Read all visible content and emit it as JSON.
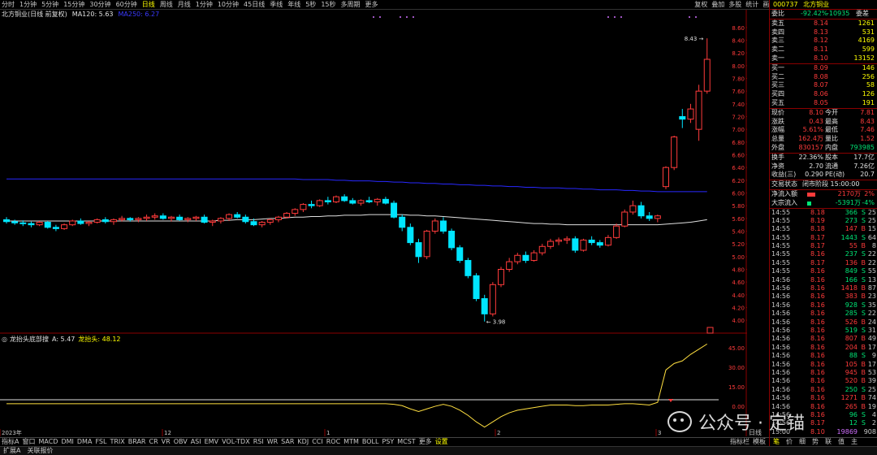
{
  "toolbar": {
    "periods": [
      "分时",
      "1分钟",
      "5分钟",
      "15分钟",
      "30分钟",
      "60分钟",
      "日线",
      "周线",
      "月线",
      "1分钟",
      "10分钟",
      "45日线",
      "季线",
      "年线",
      "5秒",
      "15秒",
      "多周期",
      "更多"
    ],
    "active_period_index": 6,
    "right_buttons": [
      "复权",
      "叠加",
      "多股",
      "统计",
      "画线",
      "F10",
      "标记",
      "+自选",
      "返回"
    ]
  },
  "chart": {
    "stock_label": "北方铜业(日线 前复权)",
    "ma_label": "MA120: 5.63",
    "ma_label2": "MA250: 6.27",
    "high_marker": "8.43",
    "low_marker": "3.98",
    "price_ticks": [
      "8.60",
      "8.40",
      "8.20",
      "8.00",
      "7.80",
      "7.60",
      "7.40",
      "7.20",
      "7.00",
      "6.80",
      "6.60",
      "6.40",
      "6.20",
      "6.00",
      "5.80",
      "5.60",
      "5.40",
      "5.20",
      "5.00",
      "4.80",
      "4.60",
      "4.40",
      "4.20",
      "4.00"
    ],
    "indicator_title": "龙抬头底部搜",
    "indicator_a": "A: 5.47",
    "indicator_b": "龙抬头: 48.12",
    "indicator_ticks": [
      "45.00",
      "30.00",
      "15.00",
      "0.00"
    ],
    "date_labels": [
      "2023年",
      "12",
      "1",
      "2",
      "3"
    ],
    "colors": {
      "up": "#ff3b3b",
      "down": "#00e5ff",
      "ma1": "#e0e0e0",
      "ma2": "#2828ff",
      "indicator": "#ffdf40"
    }
  },
  "chart_data": {
    "type": "candlestick",
    "x": [
      "2023年",
      "12",
      "1",
      "2",
      "3"
    ],
    "y_range": [
      3.9,
      8.7
    ],
    "candles": [
      [
        5.58,
        5.62,
        5.52,
        5.55
      ],
      [
        5.55,
        5.58,
        5.5,
        5.53
      ],
      [
        5.53,
        5.57,
        5.48,
        5.52
      ],
      [
        5.52,
        5.55,
        5.46,
        5.5
      ],
      [
        5.5,
        5.56,
        5.48,
        5.54
      ],
      [
        5.54,
        5.56,
        5.44,
        5.46
      ],
      [
        5.46,
        5.5,
        5.4,
        5.44
      ],
      [
        5.44,
        5.52,
        5.42,
        5.5
      ],
      [
        5.5,
        5.58,
        5.48,
        5.56
      ],
      [
        5.56,
        5.6,
        5.5,
        5.52
      ],
      [
        5.52,
        5.56,
        5.48,
        5.54
      ],
      [
        5.54,
        5.6,
        5.52,
        5.58
      ],
      [
        5.58,
        5.62,
        5.52,
        5.55
      ],
      [
        5.55,
        5.6,
        5.5,
        5.58
      ],
      [
        5.58,
        5.64,
        5.55,
        5.6
      ],
      [
        5.6,
        5.62,
        5.55,
        5.58
      ],
      [
        5.58,
        5.62,
        5.54,
        5.6
      ],
      [
        5.6,
        5.66,
        5.56,
        5.62
      ],
      [
        5.62,
        5.68,
        5.58,
        5.64
      ],
      [
        5.64,
        5.68,
        5.58,
        5.6
      ],
      [
        5.6,
        5.64,
        5.55,
        5.62
      ],
      [
        5.62,
        5.66,
        5.56,
        5.58
      ],
      [
        5.58,
        5.62,
        5.54,
        5.6
      ],
      [
        5.6,
        5.64,
        5.56,
        5.62
      ],
      [
        5.62,
        5.66,
        5.52,
        5.54
      ],
      [
        5.54,
        5.58,
        5.48,
        5.56
      ],
      [
        5.56,
        5.62,
        5.52,
        5.6
      ],
      [
        5.6,
        5.68,
        5.56,
        5.66
      ],
      [
        5.66,
        5.7,
        5.6,
        5.62
      ],
      [
        5.62,
        5.66,
        5.52,
        5.55
      ],
      [
        5.55,
        5.6,
        5.48,
        5.5
      ],
      [
        5.5,
        5.56,
        5.46,
        5.54
      ],
      [
        5.54,
        5.6,
        5.5,
        5.58
      ],
      [
        5.58,
        5.64,
        5.54,
        5.62
      ],
      [
        5.62,
        5.7,
        5.6,
        5.68
      ],
      [
        5.68,
        5.76,
        5.64,
        5.74
      ],
      [
        5.74,
        5.84,
        5.7,
        5.82
      ],
      [
        5.82,
        5.88,
        5.76,
        5.8
      ],
      [
        5.8,
        5.9,
        5.78,
        5.88
      ],
      [
        5.88,
        5.94,
        5.82,
        5.86
      ],
      [
        5.86,
        5.96,
        5.84,
        5.94
      ],
      [
        5.94,
        5.98,
        5.86,
        5.88
      ],
      [
        5.88,
        5.92,
        5.82,
        5.84
      ],
      [
        5.84,
        5.9,
        5.8,
        5.88
      ],
      [
        5.88,
        5.94,
        5.84,
        5.86
      ],
      [
        5.86,
        5.92,
        5.8,
        5.9
      ],
      [
        5.9,
        5.94,
        5.82,
        5.84
      ],
      [
        5.84,
        5.88,
        5.6,
        5.62
      ],
      [
        5.62,
        5.66,
        5.4,
        5.46
      ],
      [
        5.46,
        5.52,
        5.18,
        5.22
      ],
      [
        5.22,
        5.28,
        4.9,
        5.0
      ],
      [
        5.0,
        5.42,
        4.96,
        5.4
      ],
      [
        5.4,
        5.6,
        5.36,
        5.56
      ],
      [
        5.56,
        5.62,
        5.36,
        5.4
      ],
      [
        5.4,
        5.44,
        5.1,
        5.14
      ],
      [
        5.14,
        5.18,
        4.9,
        4.94
      ],
      [
        4.94,
        4.98,
        4.66,
        4.7
      ],
      [
        4.7,
        4.74,
        4.3,
        4.34
      ],
      [
        4.34,
        4.4,
        3.98,
        4.1
      ],
      [
        4.1,
        4.6,
        4.06,
        4.56
      ],
      [
        4.56,
        4.84,
        4.52,
        4.8
      ],
      [
        4.8,
        4.98,
        4.76,
        4.92
      ],
      [
        4.92,
        5.06,
        4.88,
        5.02
      ],
      [
        5.02,
        5.08,
        4.9,
        4.94
      ],
      [
        4.94,
        5.1,
        4.92,
        5.06
      ],
      [
        5.06,
        5.2,
        5.02,
        5.16
      ],
      [
        5.16,
        5.28,
        5.12,
        5.24
      ],
      [
        5.24,
        5.3,
        5.18,
        5.26
      ],
      [
        5.26,
        5.32,
        5.2,
        5.28
      ],
      [
        5.28,
        5.32,
        5.06,
        5.1
      ],
      [
        5.1,
        5.28,
        5.08,
        5.26
      ],
      [
        5.26,
        5.32,
        5.18,
        5.22
      ],
      [
        5.22,
        5.26,
        5.14,
        5.18
      ],
      [
        5.18,
        5.34,
        5.16,
        5.3
      ],
      [
        5.3,
        5.52,
        5.28,
        5.48
      ],
      [
        5.48,
        5.74,
        5.46,
        5.7
      ],
      [
        5.7,
        5.88,
        5.66,
        5.8
      ],
      [
        5.8,
        5.86,
        5.6,
        5.64
      ],
      [
        5.64,
        5.7,
        5.56,
        5.6
      ],
      [
        5.6,
        5.66,
        5.54,
        5.64
      ],
      [
        6.1,
        6.42,
        6.06,
        6.4
      ],
      [
        6.4,
        6.9,
        6.36,
        6.88
      ],
      [
        7.2,
        7.32,
        7.02,
        7.16
      ],
      [
        7.16,
        7.4,
        7.1,
        7.32
      ],
      [
        7.0,
        7.7,
        6.82,
        7.6
      ],
      [
        7.6,
        8.43,
        7.56,
        8.1
      ]
    ],
    "ma120": [
      5.56,
      5.56,
      5.56,
      5.56,
      5.56,
      5.56,
      5.56,
      5.56,
      5.56,
      5.56,
      5.56,
      5.56,
      5.56,
      5.56,
      5.56,
      5.56,
      5.56,
      5.56,
      5.56,
      5.56,
      5.56,
      5.56,
      5.56,
      5.56,
      5.56,
      5.56,
      5.57,
      5.57,
      5.58,
      5.58,
      5.58,
      5.59,
      5.6,
      5.6,
      5.61,
      5.62,
      5.62,
      5.63,
      5.63,
      5.64,
      5.64,
      5.65,
      5.65,
      5.65,
      5.66,
      5.66,
      5.66,
      5.66,
      5.66,
      5.65,
      5.65,
      5.64,
      5.64,
      5.63,
      5.62,
      5.61,
      5.6,
      5.59,
      5.58,
      5.57,
      5.56,
      5.55,
      5.54,
      5.53,
      5.52,
      5.52,
      5.51,
      5.51,
      5.5,
      5.5,
      5.5,
      5.5,
      5.5,
      5.5,
      5.5,
      5.5,
      5.5,
      5.5,
      5.5,
      5.5,
      5.51,
      5.52,
      5.53,
      5.54,
      5.56,
      5.58
    ],
    "ma250": [
      6.22,
      6.22,
      6.22,
      6.22,
      6.22,
      6.22,
      6.22,
      6.22,
      6.22,
      6.22,
      6.22,
      6.22,
      6.22,
      6.22,
      6.22,
      6.22,
      6.22,
      6.22,
      6.22,
      6.22,
      6.22,
      6.22,
      6.22,
      6.22,
      6.22,
      6.22,
      6.22,
      6.22,
      6.22,
      6.22,
      6.22,
      6.22,
      6.22,
      6.22,
      6.22,
      6.22,
      6.21,
      6.21,
      6.21,
      6.21,
      6.2,
      6.2,
      6.19,
      6.19,
      6.19,
      6.18,
      6.18,
      6.17,
      6.17,
      6.16,
      6.16,
      6.15,
      6.15,
      6.14,
      6.14,
      6.13,
      6.13,
      6.12,
      6.12,
      6.11,
      6.11,
      6.1,
      6.1,
      6.09,
      6.09,
      6.08,
      6.08,
      6.08,
      6.07,
      6.07,
      6.06,
      6.06,
      6.05,
      6.05,
      6.05,
      6.04,
      6.04,
      6.03,
      6.03,
      6.02,
      6.02,
      6.02,
      6.02,
      6.02,
      6.02,
      6.02
    ],
    "indicator": [
      2,
      2,
      2,
      2,
      2,
      2,
      2,
      2,
      2,
      2,
      2,
      2,
      2,
      2,
      2,
      2,
      2,
      2,
      2,
      2,
      2,
      2,
      2,
      2,
      2,
      2,
      2,
      2,
      2,
      2,
      2,
      2,
      2,
      2,
      2,
      2,
      2,
      2,
      2,
      2,
      2,
      2,
      2,
      2,
      2,
      2,
      2,
      1.5,
      0.5,
      -2,
      -4,
      -2,
      0,
      1.5,
      0,
      -3,
      -7,
      -12,
      -16,
      -12,
      -8,
      -5,
      -3,
      -2,
      -1,
      0,
      1,
      1,
      1,
      0.5,
      0.5,
      1,
      1,
      1,
      1.5,
      2,
      2,
      1.5,
      1,
      3,
      28,
      33,
      35,
      40,
      44,
      48
    ]
  },
  "right_panel": {
    "code": "000737",
    "name": "北方铜业",
    "weibi_label": "委比",
    "weibi": "-92.42%",
    "weicha_val": "-10935",
    "weicha_label": "委差",
    "asks": [
      {
        "label": "卖五",
        "price": "8.14",
        "vol": "1261"
      },
      {
        "label": "卖四",
        "price": "8.13",
        "vol": "531"
      },
      {
        "label": "卖三",
        "price": "8.12",
        "vol": "4169"
      },
      {
        "label": "卖二",
        "price": "8.11",
        "vol": "599"
      },
      {
        "label": "卖一",
        "price": "8.10",
        "vol": "13152"
      }
    ],
    "bids": [
      {
        "label": "买一",
        "price": "8.09",
        "vol": "146"
      },
      {
        "label": "买二",
        "price": "8.08",
        "vol": "256"
      },
      {
        "label": "买三",
        "price": "8.07",
        "vol": "58"
      },
      {
        "label": "买四",
        "price": "8.06",
        "vol": "126"
      },
      {
        "label": "买五",
        "price": "8.05",
        "vol": "191"
      }
    ],
    "stats": [
      {
        "l1": "现价",
        "v1": "8.10",
        "l2": "今开",
        "v2": "7.81"
      },
      {
        "l1": "涨跌",
        "v1": "0.43",
        "l2": "最高",
        "v2": "8.43"
      },
      {
        "l1": "涨幅",
        "v1": "5.61%",
        "l2": "最低",
        "v2": "7.46"
      },
      {
        "l1": "总量",
        "v1": "162.4万",
        "l2": "量比",
        "v2": "1.52"
      },
      {
        "l1": "外盘",
        "v1": "830157",
        "l2": "内盘",
        "v2": "793985"
      }
    ],
    "stats2": [
      {
        "l1": "换手",
        "v1": "22.36%",
        "l2": "股本",
        "v2": "17.7亿"
      },
      {
        "l1": "净资",
        "v1": "2.70",
        "l2": "流通",
        "v2": "7.26亿"
      },
      {
        "l1": "收益(三)",
        "v1": "0.290",
        "l2": "PE(动)",
        "v2": "20.7"
      }
    ],
    "trade_state_label": "交易状态",
    "trade_state": "闭市阶段 15:00:00",
    "flow": [
      {
        "label": "净流入额",
        "val": "2170万",
        "pct": "2%"
      },
      {
        "label": "大宗流入",
        "val": "-5391万",
        "pct": "-4%"
      }
    ],
    "ticks": [
      {
        "t": "14:55",
        "p": "8.18",
        "v": "366",
        "bs": "S",
        "n": "25"
      },
      {
        "t": "14:55",
        "p": "8.19",
        "v": "273",
        "bs": "S",
        "n": "25"
      },
      {
        "t": "14:55",
        "p": "8.18",
        "v": "147",
        "bs": "B",
        "n": "15"
      },
      {
        "t": "14:55",
        "p": "8.17",
        "v": "1443",
        "bs": "S",
        "n": "64"
      },
      {
        "t": "14:55",
        "p": "8.17",
        "v": "55",
        "bs": "B",
        "n": "8"
      },
      {
        "t": "14:55",
        "p": "8.16",
        "v": "237",
        "bs": "S",
        "n": "22"
      },
      {
        "t": "14:55",
        "p": "8.17",
        "v": "136",
        "bs": "B",
        "n": "22"
      },
      {
        "t": "14:55",
        "p": "8.16",
        "v": "849",
        "bs": "S",
        "n": "55"
      },
      {
        "t": "14:56",
        "p": "8.16",
        "v": "166",
        "bs": "S",
        "n": "13"
      },
      {
        "t": "14:56",
        "p": "8.16",
        "v": "1418",
        "bs": "B",
        "n": "87"
      },
      {
        "t": "14:56",
        "p": "8.16",
        "v": "383",
        "bs": "B",
        "n": "23"
      },
      {
        "t": "14:56",
        "p": "8.16",
        "v": "928",
        "bs": "S",
        "n": "35"
      },
      {
        "t": "14:56",
        "p": "8.16",
        "v": "285",
        "bs": "S",
        "n": "22"
      },
      {
        "t": "14:56",
        "p": "8.16",
        "v": "526",
        "bs": "B",
        "n": "24"
      },
      {
        "t": "14:56",
        "p": "8.16",
        "v": "519",
        "bs": "S",
        "n": "31"
      },
      {
        "t": "14:56",
        "p": "8.16",
        "v": "807",
        "bs": "B",
        "n": "49"
      },
      {
        "t": "14:56",
        "p": "8.16",
        "v": "204",
        "bs": "B",
        "n": "17"
      },
      {
        "t": "14:56",
        "p": "8.16",
        "v": "88",
        "bs": "S",
        "n": "9"
      },
      {
        "t": "14:56",
        "p": "8.16",
        "v": "105",
        "bs": "B",
        "n": "17"
      },
      {
        "t": "14:56",
        "p": "8.16",
        "v": "945",
        "bs": "B",
        "n": "53"
      },
      {
        "t": "14:56",
        "p": "8.16",
        "v": "520",
        "bs": "B",
        "n": "39"
      },
      {
        "t": "14:56",
        "p": "8.16",
        "v": "250",
        "bs": "S",
        "n": "25"
      },
      {
        "t": "14:56",
        "p": "8.16",
        "v": "1271",
        "bs": "B",
        "n": "74"
      },
      {
        "t": "14:56",
        "p": "8.16",
        "v": "265",
        "bs": "B",
        "n": "19"
      },
      {
        "t": "14:56",
        "p": "8.16",
        "v": "96",
        "bs": "S",
        "n": "4"
      },
      {
        "t": "14:56",
        "p": "8.17",
        "v": "12",
        "bs": "S",
        "n": "2"
      },
      {
        "t": "15:00",
        "p": "8.10",
        "v": "19869",
        "bs": "",
        "n": "908"
      }
    ],
    "tabs": [
      "笔",
      "价",
      "细",
      "势",
      "联",
      "值",
      "主"
    ]
  },
  "indicator_tabs": [
    "指标A",
    "窗口",
    "MACD",
    "DMI",
    "DMA",
    "FSL",
    "TRIX",
    "BRAR",
    "CR",
    "VR",
    "OBV",
    "ASI",
    "EMV",
    "VOL-TDX",
    "RSI",
    "WR",
    "SAR",
    "KDJ",
    "CCI",
    "ROC",
    "MTM",
    "BOLL",
    "PSY",
    "MCST",
    "更多",
    "设置"
  ],
  "indicator_right": [
    "指标栏",
    "模板"
  ],
  "status_bar": [
    "扩展A",
    "关联报价"
  ],
  "tab_small": "日线",
  "watermark": {
    "text": "公众号 · 定锚"
  }
}
